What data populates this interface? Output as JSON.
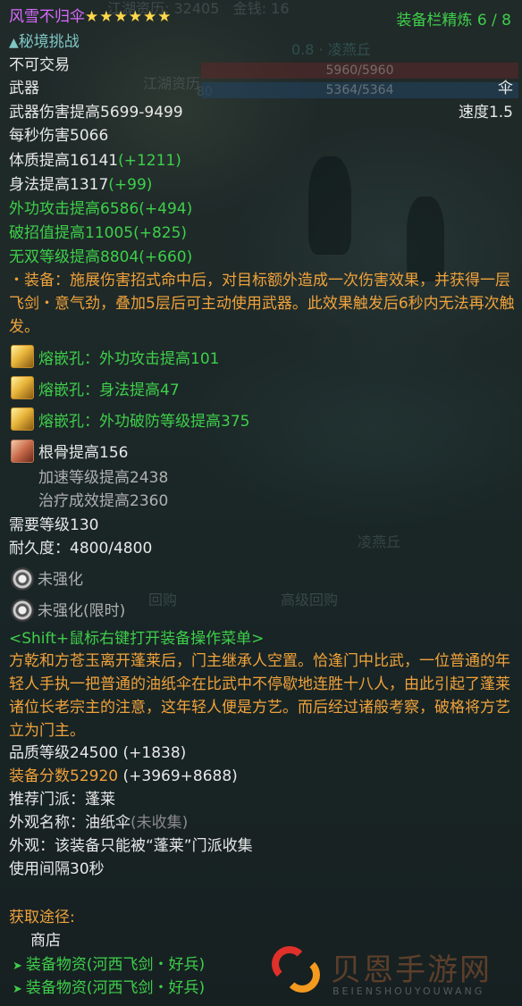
{
  "background": {
    "hp": "5960/5960",
    "mp": "5364/5364",
    "location_top": "0.8 · 凌燕丘",
    "location_mid": "凌燕丘",
    "topbar_left": "江湖资历: 32405",
    "topbar_mid": "金钱: 16",
    "npc_tag": "江湖资历",
    "level_badge": "80",
    "menu_repurchase": "回购",
    "menu_advanced_repurchase": "高级回购"
  },
  "header": {
    "item_name": "风雪不归伞",
    "stars": "★★★★★★",
    "refine": "装备栏精炼 6 / 8",
    "challenge": "秘境挑战",
    "untradeable": "不可交易"
  },
  "weapon": {
    "slot": "武器",
    "type": "伞",
    "damage": "武器伤害提高5699-9499",
    "speed": "速度1.5",
    "dps": "每秒伤害5066"
  },
  "stats": [
    {
      "base": "体质提高16141",
      "bonus": "(+1211)",
      "color": "white"
    },
    {
      "base": "身法提高1317",
      "bonus": "(+99)",
      "color": "white"
    },
    {
      "base": "外功攻击提高6586",
      "bonus": "(+494)",
      "color": "green"
    },
    {
      "base": "破招值提高11005",
      "bonus": "(+825)",
      "color": "green"
    },
    {
      "base": "无双等级提高8804",
      "bonus": "(+660)",
      "color": "green"
    }
  ],
  "effect_text": "・装备：施展伤害招式命中后，对目标额外造成一次伤害效果，并获得一层飞剑・意气劲，叠加5层后可主动使用武器。此效果触发后6秒内无法再次触发。",
  "sockets": [
    {
      "text": "熔嵌孔：外功攻击提高101",
      "icon": "yellow-gem-icon"
    },
    {
      "text": "熔嵌孔：身法提高47",
      "icon": "yellow-gem-icon"
    },
    {
      "text": "熔嵌孔：外功破防等级提高375",
      "icon": "yellow-gem-icon"
    }
  ],
  "enchant": {
    "main": "根骨提高156",
    "sub1": "加速等级提高2438",
    "sub2": "治疗成效提高2360"
  },
  "requirements": {
    "level": "需要等级130",
    "durability": "耐久度：4800/4800"
  },
  "strengthen": {
    "normal": "未强化",
    "limited": "未强化(限时)"
  },
  "shift_hint": "<Shift+鼠标右键打开装备操作菜单>",
  "lore": "方乾和方苍玉离开蓬莱后，门主继承人空置。恰逢门中比武，一位普通的年轻人手执一把普通的油纸伞在比武中不停歇地连胜十八人，由此引起了蓬莱诸位长老宗主的注意，这年轻人便是方艺。而后经过诸般考察，破格将方艺立为门主。",
  "quality": {
    "label": "品质等级24500",
    "bonus": "(+1838)"
  },
  "score": {
    "label": "装备分数52920",
    "bonus": "(+3969+8688)"
  },
  "school": "推荐门派：蓬莱",
  "appearance": {
    "name_label": "外观名称：油纸伞",
    "name_status": "(未收集)",
    "note": "外观：该装备只能被“蓬莱”门派收集"
  },
  "cooldown": "使用间隔30秒",
  "acquire": {
    "title": "获取途径:",
    "shop": "商店",
    "sources": [
      "装备物资(河西飞剑・好兵)",
      "装备物资(河西飞剑・好兵)"
    ]
  },
  "watermark": {
    "text": "贝恩手游网",
    "sub": "BEIENSHOUYOUWANG"
  },
  "colors": {
    "name": "#d86cff",
    "star": "#ffd84a",
    "green": "#3ecf4a",
    "orange": "#f0a23b"
  }
}
